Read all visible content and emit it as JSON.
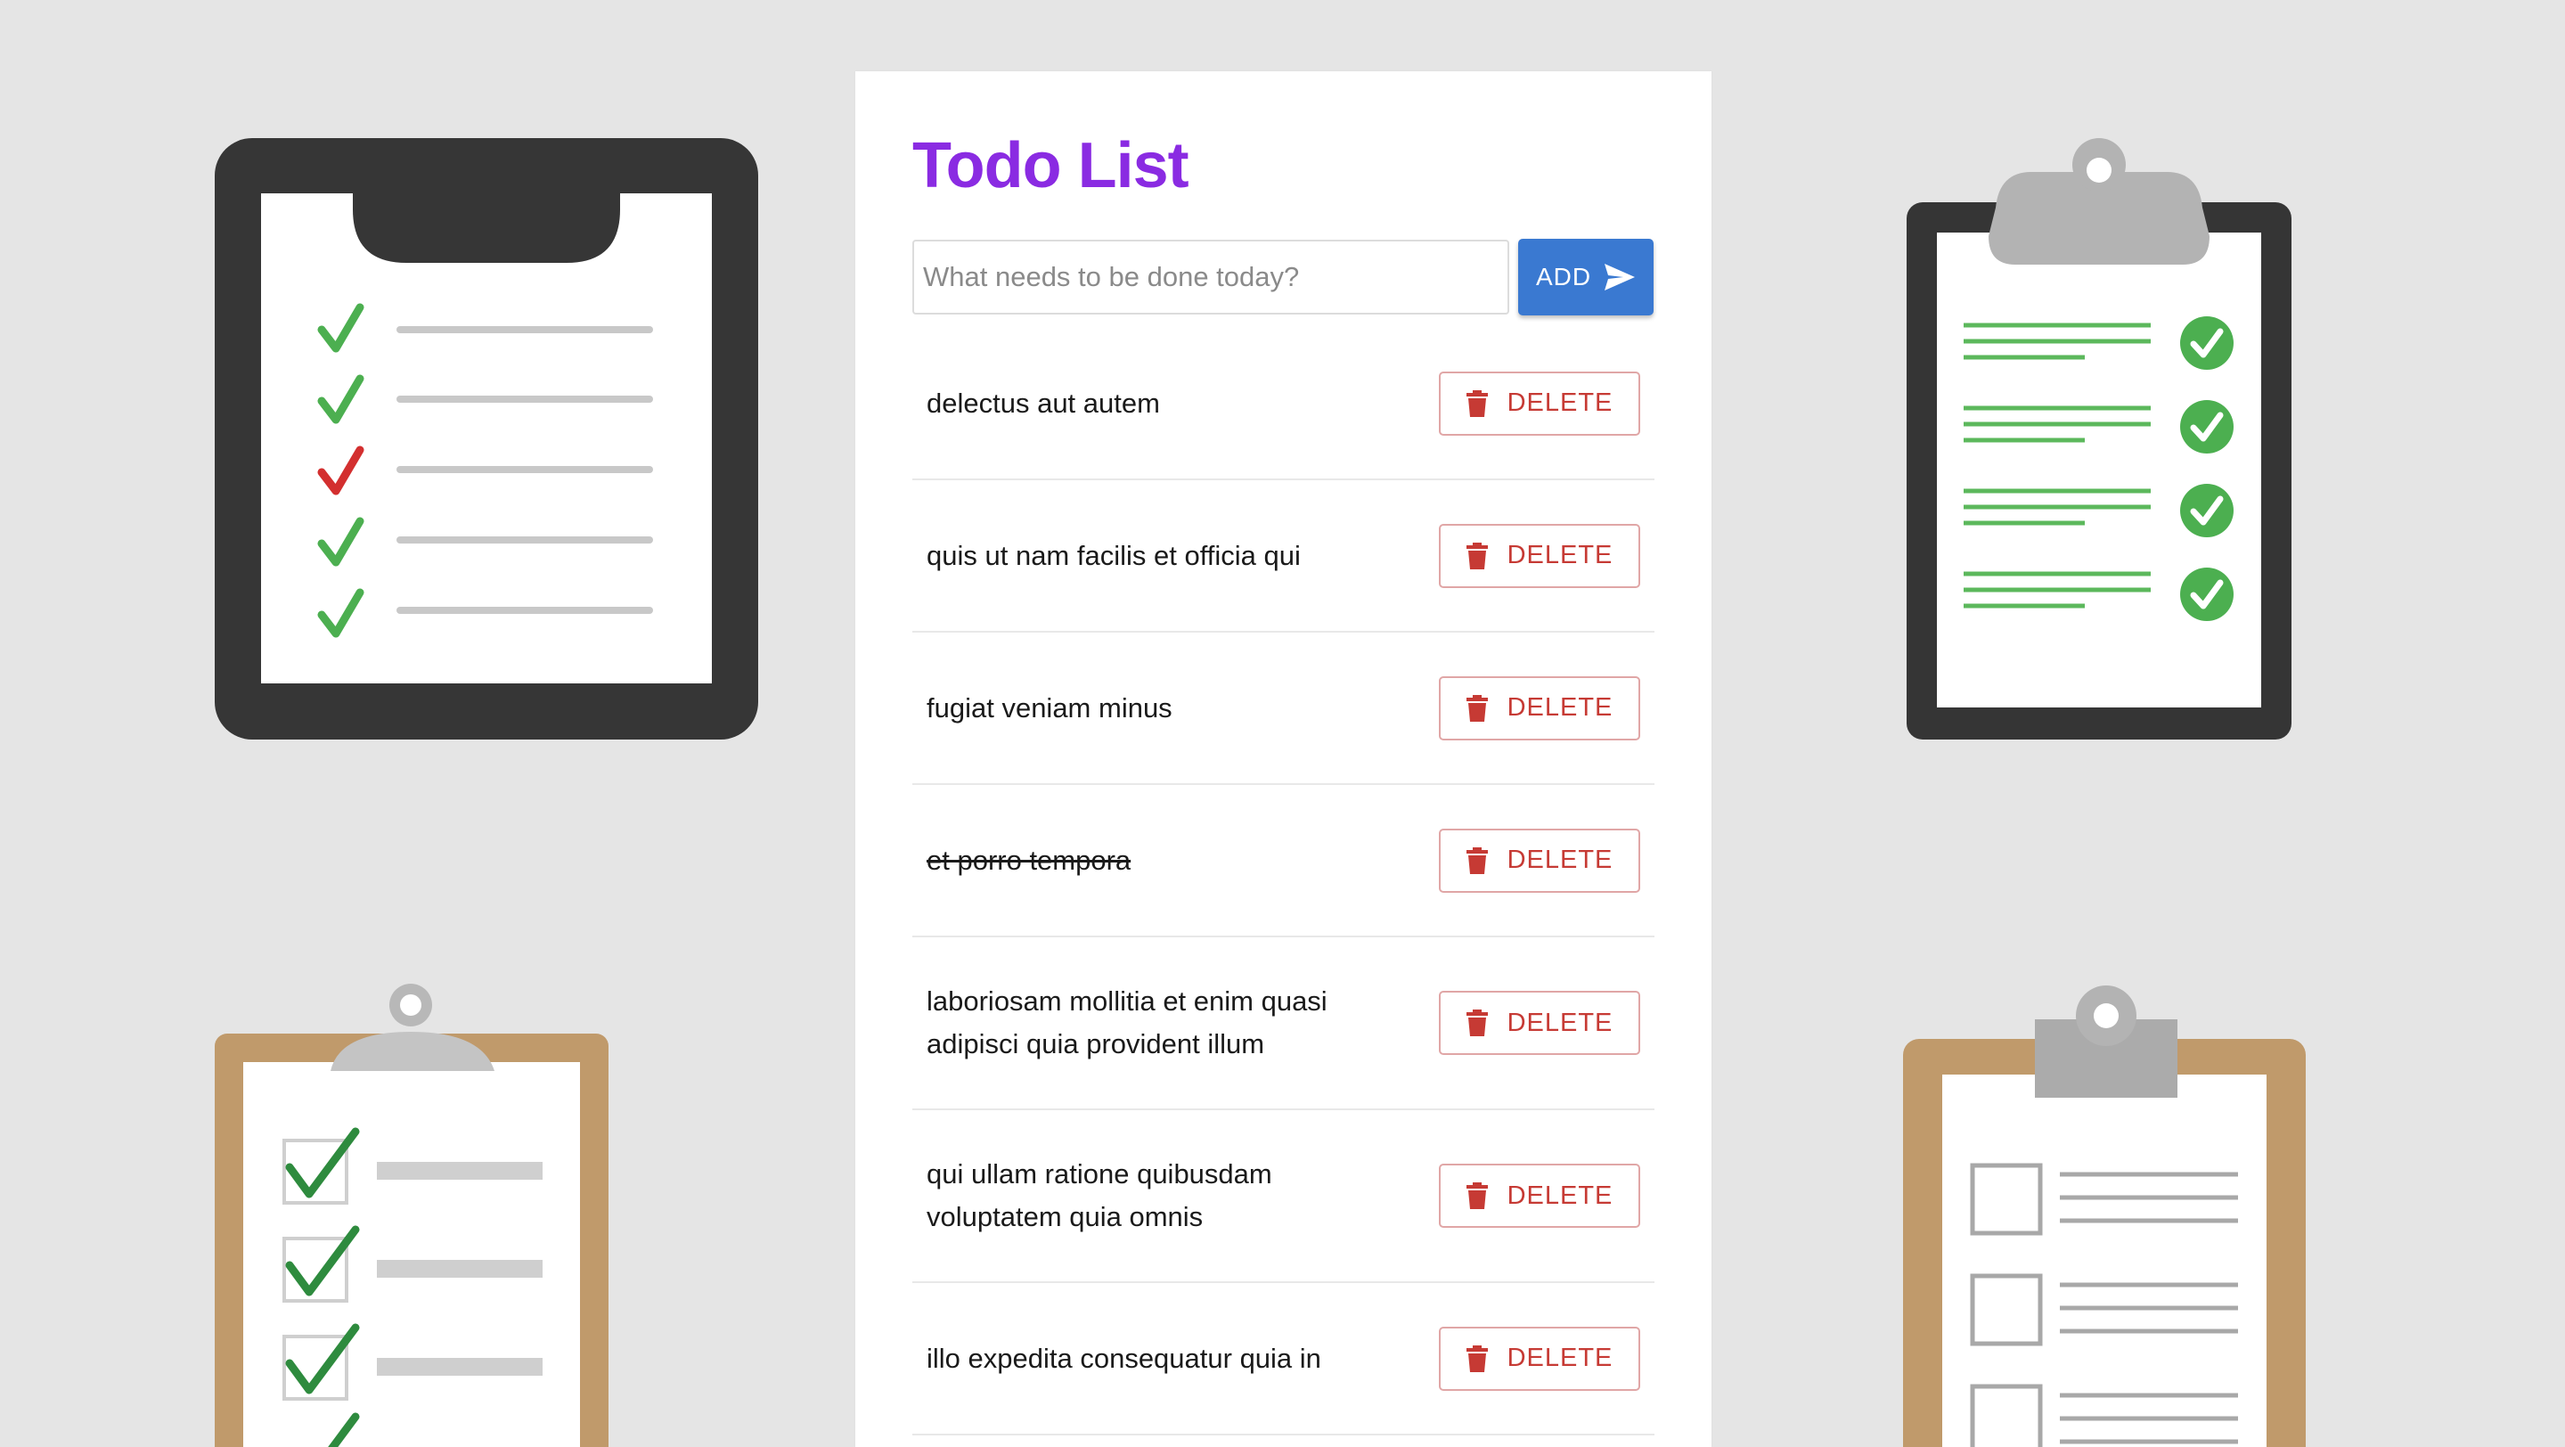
{
  "app": {
    "title": "Todo List"
  },
  "form": {
    "input_value": "",
    "placeholder": "What needs to be done today?",
    "add_label": "ADD",
    "add_icon": "send-icon"
  },
  "todos": [
    {
      "text": "delectus aut autem",
      "completed": false,
      "delete_label": "DELETE"
    },
    {
      "text": "quis ut nam facilis et officia qui",
      "completed": false,
      "delete_label": "DELETE"
    },
    {
      "text": "fugiat veniam minus",
      "completed": false,
      "delete_label": "DELETE"
    },
    {
      "text": "et porro tempora",
      "completed": true,
      "delete_label": "DELETE"
    },
    {
      "text": "laboriosam mollitia et enim quasi adipisci quia provident illum",
      "completed": false,
      "delete_label": "DELETE"
    },
    {
      "text": "qui ullam ratione quibusdam voluptatem quia omnis",
      "completed": false,
      "delete_label": "DELETE"
    },
    {
      "text": "illo expedita consequatur quia in",
      "completed": false,
      "delete_label": "DELETE"
    }
  ],
  "icons": {
    "delete": "trash-icon",
    "decor": [
      "clipboard-checklist-icon",
      "clipboard-checkmarks-icon",
      "clipboard-checkbox-icon",
      "clipboard-empty-checkbox-icon"
    ]
  },
  "colors": {
    "background": "#e5e5e5",
    "title": "#8a2be2",
    "add_button": "#3a79d1",
    "delete": "#c63a34",
    "delete_border": "#e0a6a6",
    "check_green": "#4caf50",
    "check_red": "#d32f2f"
  }
}
